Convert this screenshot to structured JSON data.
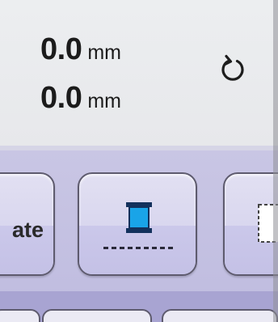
{
  "readout": {
    "x_value": "0.0",
    "x_unit": "mm",
    "y_value": "0.0",
    "y_unit": "mm"
  },
  "toolbar": {
    "left_button_label": "ate"
  },
  "icons": {
    "reset": "rotate-refresh-icon",
    "spool": "thread-spool-icon",
    "frame": "dashed-frame-icon"
  },
  "colors": {
    "spool_thread": "#19a4e8",
    "band": "#c3c0e2",
    "frame_accent": "#d4293a"
  }
}
